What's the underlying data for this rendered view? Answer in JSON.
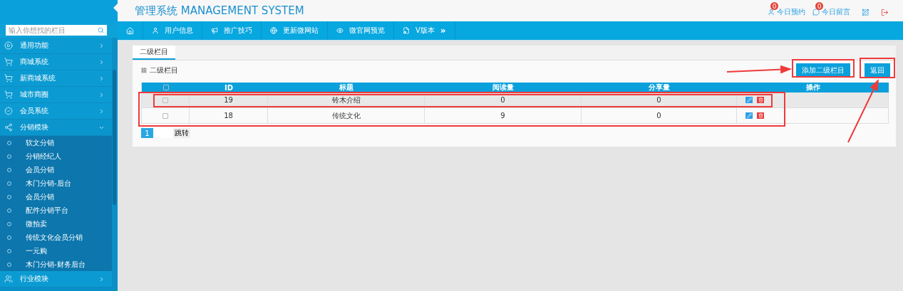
{
  "header": {
    "title": "管理系统 MANAGEMENT SYSTEM",
    "links": [
      {
        "label": "今日预约",
        "count": "0"
      },
      {
        "label": "今日留言",
        "count": "0"
      }
    ]
  },
  "search": {
    "placeholder": "输入你想找的栏目"
  },
  "nav": {
    "items": [
      {
        "label": "用户信息"
      },
      {
        "label": "推广技巧"
      },
      {
        "label": "更新微网站"
      },
      {
        "label": "微官网预览"
      },
      {
        "label": "V版本"
      }
    ],
    "more": "»"
  },
  "sidebar": {
    "items": [
      {
        "label": "通用功能",
        "expanded": false
      },
      {
        "label": "商城系统",
        "expanded": false
      },
      {
        "label": "新商城系统",
        "expanded": false
      },
      {
        "label": "城市商圈",
        "expanded": false
      },
      {
        "label": "会员系统",
        "expanded": false
      },
      {
        "label": "分销模块",
        "expanded": true,
        "children": [
          {
            "label": "软文分销"
          },
          {
            "label": "分销经纪人"
          },
          {
            "label": "会员分销"
          },
          {
            "label": "木门分销-后台"
          },
          {
            "label": "会员分销"
          },
          {
            "label": "配件分销平台"
          },
          {
            "label": "微拍卖"
          },
          {
            "label": "传统文化会员分销"
          },
          {
            "label": "一元购"
          },
          {
            "label": "木门分销-财务后台"
          }
        ]
      },
      {
        "label": "行业模块",
        "expanded": false
      }
    ]
  },
  "tabs": [
    {
      "label": "二级栏目",
      "selected": true
    }
  ],
  "section_title": "二级栏目",
  "buttons": [
    {
      "label": "添加二级栏目"
    },
    {
      "label": "返回"
    }
  ],
  "table": {
    "header_checked": false,
    "columns": [
      "ID",
      "标题",
      "阅读量",
      "分享量",
      "操作"
    ],
    "rows": [
      {
        "checked": false,
        "selected": true,
        "cells": [
          "19",
          "铃木介绍",
          "0",
          "0"
        ]
      },
      {
        "checked": false,
        "selected": false,
        "cells": [
          "18",
          "传统文化",
          "9",
          "0"
        ]
      }
    ]
  },
  "pagination": {
    "pages": [
      {
        "label": "1",
        "selected": true
      }
    ],
    "go": "跳转"
  }
}
